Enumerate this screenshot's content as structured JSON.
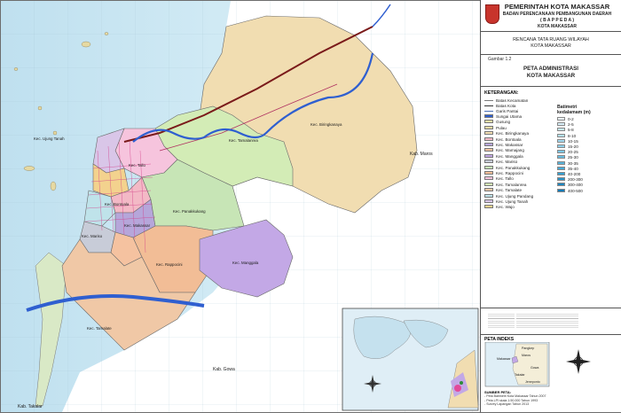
{
  "header": {
    "line1": "PEMERINTAH KOTA MAKASSAR",
    "line2": "BADAN PERENCANAAN PEMBANGUNAN DAERAH",
    "line3": "( B A P P E D A )",
    "line4": "KOTA MAKASSAR"
  },
  "plan_title": {
    "line1": "RENCANA TATA RUANG WILAYAH",
    "line2": "KOTA MAKASSAR"
  },
  "figure": {
    "number": "Gambar 1.2",
    "title1": "PETA ADMINISTRASI",
    "title2": "KOTA MAKASSAR"
  },
  "legend": {
    "heading": "KETERANGAN:",
    "lines": [
      {
        "label": "Batas Kecamatan",
        "color": "#7a7a7a"
      },
      {
        "label": "Batas Kota",
        "color": "#333333"
      },
      {
        "label": "Garis Pantai",
        "color": "#4a6fb5"
      }
    ],
    "areas": [
      {
        "label": "Sungai Utama",
        "color": "#2f5fd0"
      },
      {
        "label": "Gusung",
        "color": "#e8e0a8"
      },
      {
        "label": "Pulau",
        "color": "#e6d9a2"
      },
      {
        "label": "Kec. Biringkanaya",
        "color": "#f1ddb1"
      },
      {
        "label": "Kec. Bontoala",
        "color": "#f3b9c6"
      },
      {
        "label": "Kec. Makassar",
        "color": "#b6a6da"
      },
      {
        "label": "Kec. Mamajang",
        "color": "#f5c2a0"
      },
      {
        "label": "Kec. Manggala",
        "color": "#c3a8e6"
      },
      {
        "label": "Kec. Mariso",
        "color": "#c8ccd8"
      },
      {
        "label": "Kec. Panakkukang",
        "color": "#c7e5b6"
      },
      {
        "label": "Kec. Rappocini",
        "color": "#f2bd96"
      },
      {
        "label": "Kec. Tallo",
        "color": "#f6c4dd"
      },
      {
        "label": "Kec. Tamalanrea",
        "color": "#d3ecb6"
      },
      {
        "label": "Kec. Tamalate",
        "color": "#f0c8a6"
      },
      {
        "label": "Kec. Ujung Pandang",
        "color": "#bfe3ea"
      },
      {
        "label": "Kec. Ujung Tanah",
        "color": "#d9c6e8"
      },
      {
        "label": "Kec. Wajo",
        "color": "#f3d28e"
      }
    ],
    "bathymetry_title1": "Batimetri",
    "bathymetry_title2": "kedalamam (m)",
    "bathymetry": [
      {
        "label": "0-2",
        "color": "#eaf6fb"
      },
      {
        "label": "2-5",
        "color": "#d8eff8"
      },
      {
        "label": "5-8",
        "color": "#c6e8f5"
      },
      {
        "label": "8-10",
        "color": "#b4e0f1"
      },
      {
        "label": "10-15",
        "color": "#a1d8ee"
      },
      {
        "label": "15-20",
        "color": "#8ecfe9"
      },
      {
        "label": "20-25",
        "color": "#7bc6e4"
      },
      {
        "label": "25-30",
        "color": "#69bde0"
      },
      {
        "label": "30-35",
        "color": "#57b3db"
      },
      {
        "label": "35-40",
        "color": "#46a9d6"
      },
      {
        "label": "40-200",
        "color": "#369fd0"
      },
      {
        "label": "200-300",
        "color": "#2a93c8"
      },
      {
        "label": "300-400",
        "color": "#1f86bf"
      },
      {
        "label": "400-500",
        "color": "#1479b4"
      }
    ]
  },
  "index": {
    "title": "PETA INDEKS",
    "places": [
      "Pangkep",
      "Maros",
      "Makassar",
      "Gowa",
      "Takalar",
      "Jeneponto"
    ]
  },
  "sources": {
    "title": "SUMBER PETA:",
    "lines": [
      "- Peta Batimetri Kota Makassar Tahun 2007",
      "- Peta LPI skala 1:50.000 Tahun 1993",
      "- Survey Lapangan Tahun 2013"
    ]
  },
  "map_labels": {
    "biringkanaya": "Kec. Biringkanaya",
    "tamalanrea": "Kec. Tamalanrea",
    "ujung_tanah": "Kec. Ujung Tanah",
    "tallo": "Kec. Tallo",
    "bontoala": "Kec. Bontoala",
    "panakkukang": "Kec. Panakkukang",
    "rappocini": "Kec. Rappocini",
    "manggala": "Kec. Manggala",
    "tamalate": "Kec. Tamalate",
    "mariso": "Kec. Mariso",
    "makassar": "Kec. Makassar",
    "maros": "Kab. Maros",
    "gowa": "Kab. Gowa",
    "takalar": "Kab. Takalar"
  }
}
